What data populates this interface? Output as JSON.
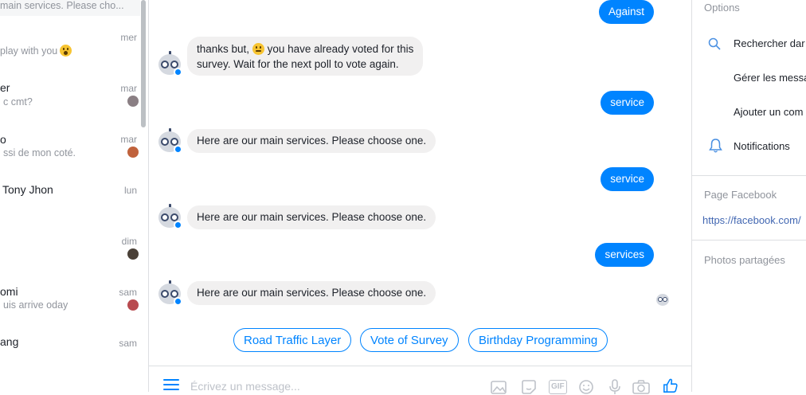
{
  "sidebar": {
    "top_preview": "main services. Please cho...",
    "items": [
      {
        "name": "",
        "preview": "play with you",
        "time": "mer"
      },
      {
        "name": "er",
        "preview": "c cmt?",
        "time": "mar"
      },
      {
        "name": "o",
        "preview": "ssi de mon coté.",
        "time": "mar"
      },
      {
        "name": "Tony Jhon",
        "preview": "",
        "time": "lun"
      },
      {
        "name": "",
        "preview": "",
        "time": "dim"
      },
      {
        "name": "omi",
        "preview": "uis arrive oday",
        "time": "sam"
      },
      {
        "name": "ang",
        "preview": "",
        "time": "sam"
      }
    ]
  },
  "chat": {
    "messages": [
      {
        "from": "user",
        "text": "Against"
      },
      {
        "from": "bot",
        "text_before_emoji": "thanks but,",
        "text_after_emoji": "you have already voted for this",
        "text_line2": "survey.  Wait for the next poll to vote again."
      },
      {
        "from": "user",
        "text": "service"
      },
      {
        "from": "bot",
        "text": "Here are our main services. Please choose one."
      },
      {
        "from": "user",
        "text": "service"
      },
      {
        "from": "bot",
        "text": "Here are our main services. Please choose one."
      },
      {
        "from": "user",
        "text": "services"
      },
      {
        "from": "bot",
        "text": "Here are our main services. Please choose one."
      }
    ],
    "quick_replies": [
      "Road Traffic Layer",
      "Vote of Survey",
      "Birthday Programming"
    ],
    "composer": {
      "placeholder": "Écrivez un message...",
      "value": ""
    },
    "composer_tools": [
      "image-icon",
      "sticker-icon",
      "gif-icon",
      "emoji-icon",
      "microphone-icon",
      "camera-icon",
      "like-icon"
    ],
    "gif_label": "GIF"
  },
  "info_panel": {
    "options_title": "Options",
    "options": [
      {
        "icon": "search-icon",
        "label": "Rechercher dar"
      },
      {
        "icon": "",
        "label": "Gérer les messa"
      },
      {
        "icon": "",
        "label": "Ajouter un com"
      },
      {
        "icon": "bell-icon",
        "label": "Notifications"
      }
    ],
    "page_title": "Page Facebook",
    "page_link": "https://facebook.com/",
    "photos_title": "Photos partagées"
  },
  "colors": {
    "accent": "#0084ff",
    "bubble_in": "#f1f0f0",
    "muted": "#90949c"
  }
}
